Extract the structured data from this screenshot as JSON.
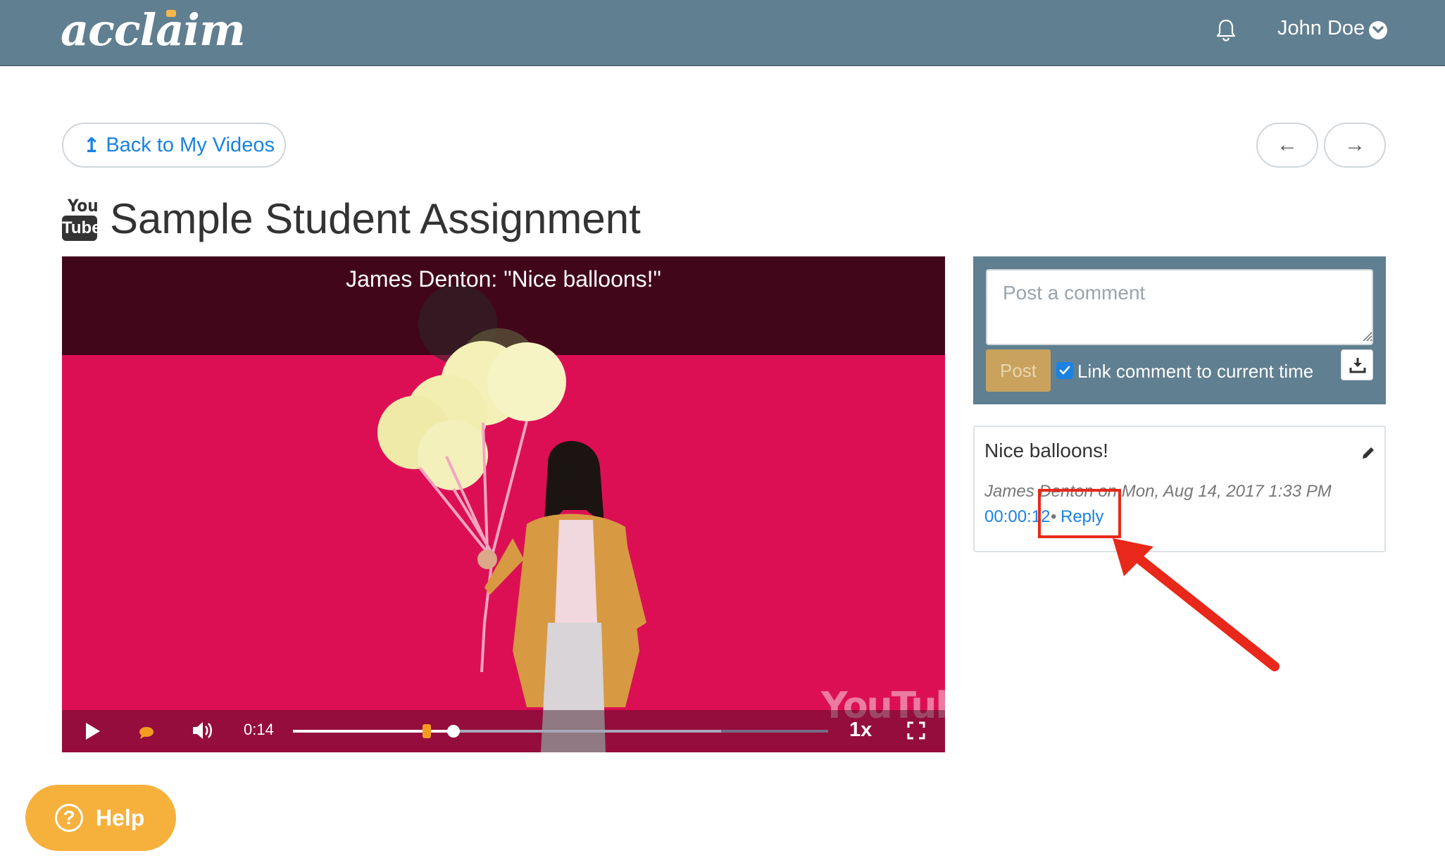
{
  "header": {
    "logo": "acclaim",
    "user_name": "John Doe",
    "icons": {
      "notifications": "bell-icon",
      "user_menu": "chevron-down-circle-icon"
    }
  },
  "toolbar": {
    "back_label": "Back to My Videos",
    "prev_label": "←",
    "next_label": "→"
  },
  "page": {
    "source_badge_you": "You",
    "source_badge_tube": "Tube",
    "title": "Sample Student Assignment"
  },
  "video": {
    "caption": "James Denton: \"Nice balloons!\"",
    "current_time": "0:14",
    "speed": "1x",
    "progress_fraction": 0.3,
    "buffered_fraction": 0.8,
    "comment_marker_fraction": 0.25,
    "watermark": "YouTube",
    "colors": {
      "background": "#dc0f55",
      "header_band": "#42061b",
      "marker": "#f39c1f"
    }
  },
  "comment_form": {
    "placeholder": "Post a comment",
    "post_label": "Post",
    "link_time_label": "Link comment to current time",
    "link_time_checked": true
  },
  "comments": [
    {
      "text": "Nice balloons!",
      "meta": "James Denton on Mon, Aug 14, 2017 1:33 PM",
      "timestamp": "00:00:12",
      "separator": "•",
      "reply_label": "Reply"
    }
  ],
  "help": {
    "label": "Help",
    "icon": "?"
  },
  "colors": {
    "topbar": "#607f90",
    "link": "#1a82e2",
    "accent": "#f6b13d",
    "annotation": "#e8281a"
  }
}
